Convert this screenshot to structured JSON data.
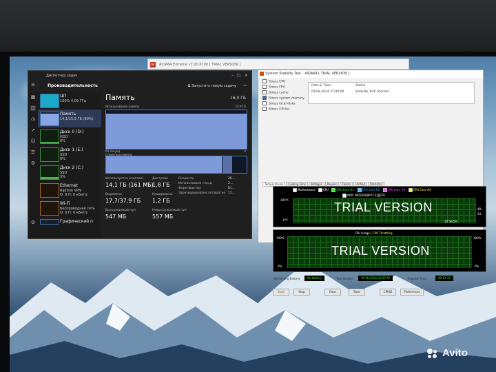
{
  "task_manager": {
    "title": "Диспетчер задач",
    "section": "Производительность",
    "run_task": "Запустить новую задачу",
    "items": [
      {
        "name": "ЦП",
        "line1": "100% 4,09 ГГц",
        "line2": ""
      },
      {
        "name": "Память",
        "line1": "14,1/15,9 ГБ (89%)",
        "line2": ""
      },
      {
        "name": "Диск 0 (D:)",
        "line1": "HDD",
        "line2": "0%"
      },
      {
        "name": "Диск 1 (E:)",
        "line1": "SSD",
        "line2": "0%"
      },
      {
        "name": "Диск 2 (C:)",
        "line1": "SSD",
        "line2": "3%"
      },
      {
        "name": "Ethernet",
        "line1": "Radmin VPN",
        "line2": "О: 0 П: 0 кбит/с"
      },
      {
        "name": "Wi-Fi",
        "line1": "Беспроводная сеть",
        "line2": "О: 0 П: 0 кбит/с"
      },
      {
        "name": "Графический п",
        "line1": "",
        "line2": ""
      }
    ],
    "memory": {
      "title": "Память",
      "total": "16,0 ГБ",
      "usage_label": "Использование памяти",
      "usage_max": "15,9 ГБ",
      "sixty_sec": "60 секунд",
      "zero": "0",
      "struct_label": "Структура памяти",
      "stats": {
        "in_use_label": "Используется (сжатая)",
        "in_use_value": "14,1 ГБ (161 МБ)",
        "available_label": "Доступно",
        "available_value": "1,8 ГБ",
        "committed_label": "Выделено",
        "committed_value": "17,7/37,9 ГБ",
        "cached_label": "Кэшировано",
        "cached_value": "1,2 ГБ",
        "paged_label": "Выгружаемый пул",
        "paged_value": "547 МБ",
        "nonpaged_label": "Невыгружаемый пул",
        "nonpaged_value": "557 МБ",
        "speed_label": "Скорость:",
        "speed_value": "26...",
        "slots_label": "Использовано гнезд",
        "slots_value": "2...",
        "form_label": "Форм-фактор:",
        "form_value": "DI...",
        "reserved_label": "Зарезервировано аппаратно",
        "reserved_value": "11..."
      },
      "usage_fraction": 0.89
    }
  },
  "aida_back": {
    "logo": "64",
    "title": "AIDA64 Extreme v7.00.6700 [ TRIAL VERSION ]"
  },
  "stability": {
    "title": "System Stability Test - AIDA64 [ TRIAL VERSION ]",
    "options": [
      {
        "label": "Stress CPU",
        "checked": false
      },
      {
        "label": "Stress FPU",
        "checked": false
      },
      {
        "label": "Stress cache",
        "checked": false
      },
      {
        "label": "Stress system memory",
        "checked": true
      },
      {
        "label": "Stress local disks",
        "checked": false
      },
      {
        "label": "Stress GPU(s)",
        "checked": false
      }
    ],
    "table": {
      "col1": "Date & Time",
      "col2": "Status",
      "date": "09.08.2024 21:00:00",
      "status": "Stability Test: Started"
    },
    "tabs": [
      "Temperatures",
      "Cooling Fans",
      "Voltages",
      "Powers",
      "Clocks",
      "Unified",
      "Statistics"
    ],
    "temp_graph": {
      "legend": [
        "Motherboard",
        "CPU",
        "CPU Core #1",
        "CPU Core #2",
        "CPU Core #3",
        "CPU Core #4"
      ],
      "legend_colors": [
        "#ffffff",
        "#ffffff",
        "#22ff22",
        "#3fb6ff",
        "#ff55ff",
        "#ffff44"
      ],
      "drive": "WDC WD3200BPVT-22JJ5T0",
      "top": "100°C",
      "bottom": "0°C",
      "right1": "48",
      "right2": "24",
      "time": "20:59:59",
      "watermark": "TRIAL VERSION"
    },
    "cpu_graph": {
      "legend1": "CPU Usage",
      "legend2": "CPU Throttling",
      "top_left": "100%",
      "bottom_left": "0%",
      "top_right": "100%",
      "bottom_right": "0%",
      "watermark": "TRIAL VERSION"
    },
    "status": {
      "battery_label": "Remaining Battery:",
      "battery_value": "No battery",
      "started_label": "Test Started:",
      "started_value": "09.08.2024 20:59:59",
      "elapsed_label": "Elapsed Time:",
      "elapsed_value": "00:01:30"
    },
    "buttons": [
      "Start",
      "Stop",
      "Clear",
      "Save",
      "CPUID",
      "Preferences"
    ]
  },
  "watermark": {
    "brand": "Avito"
  }
}
